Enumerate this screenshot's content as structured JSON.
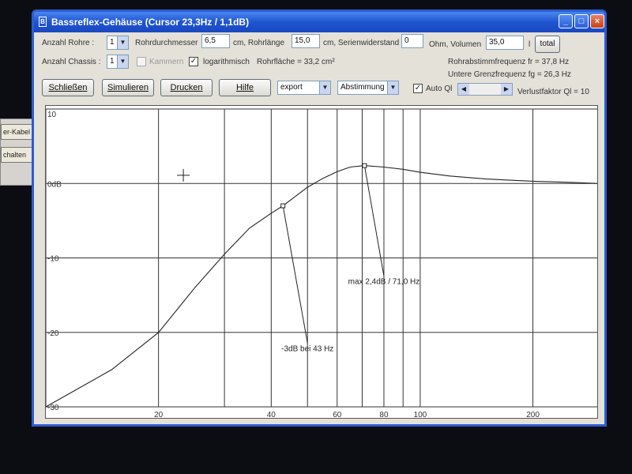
{
  "background_window": {
    "items": [
      "er-Kabel",
      "chalten"
    ]
  },
  "window": {
    "title": "Bassreflex-Gehäuse (Cursor 23,3Hz / 1,1dB)",
    "minimize": "_",
    "maximize": "□",
    "close": "×"
  },
  "params": {
    "anzahl_rohre_label": "Anzahl Rohre :",
    "anzahl_rohre_value": "1",
    "rohrdurchmesser_label": "Rohrdurchmesser",
    "rohrdurchmesser_value": "6,5",
    "rohrlaenge_label": "cm, Rohrlänge",
    "rohrlaenge_value": "15,0",
    "serienwiderstand_label": "cm, Serienwiderstand",
    "serienwiderstand_value": "0",
    "volumen_label": "Ohm, Volumen",
    "volumen_value": "35,0",
    "volumen_unit": "l",
    "total_button": "total",
    "anzahl_chassis_label": "Anzahl Chassis :",
    "anzahl_chassis_value": "1",
    "kammern_label": "Kammern",
    "kammern_checked": false,
    "log_label": "logarithmisch",
    "log_checked": true,
    "rohrflaeche_text": "Rohrfläche = 33,2 cm²",
    "rohrabstimm_text": "Rohrabstimmfrequenz fr = 37,8 Hz",
    "grenzfrequenz_text": "Untere Grenzfrequenz fg = 26,3 Hz"
  },
  "toolbar": {
    "schliessen": "Schließen",
    "simulieren": "Simulieren",
    "drucken": "Drucken",
    "hilfe": "Hilfe",
    "export_value": "export",
    "abstimmung_value": "Abstimmung",
    "auto_ql_label": "Auto Ql",
    "auto_ql_checked": true,
    "verlustfaktor_text": "Verlustfaktor Ql = 10"
  },
  "chart_data": {
    "type": "line",
    "x_scale": "log",
    "xlim": [
      10,
      300
    ],
    "ylim": [
      -30,
      10
    ],
    "x_ticks": [
      20,
      40,
      60,
      80,
      100,
      200
    ],
    "x_tick_labels": [
      "20",
      "40",
      "60",
      "80",
      "100",
      "200"
    ],
    "y_ticks": [
      10,
      0,
      -10,
      -20,
      -30
    ],
    "y_tick_labels": [
      "10",
      "0dB",
      "-10",
      "-20",
      "-30"
    ],
    "x_gridlines": [
      10,
      20,
      30,
      40,
      50,
      60,
      70,
      80,
      90,
      100,
      200,
      300
    ],
    "y_gridlines": [
      10,
      0,
      -10,
      -20,
      -30
    ],
    "grid": true,
    "series": [
      {
        "x": [
          10,
          15,
          20,
          25,
          30,
          35,
          40,
          43,
          50,
          55,
          60,
          65,
          71,
          80,
          90,
          100,
          120,
          150,
          200,
          250,
          300
        ],
        "y": [
          -30.0,
          -25.0,
          -20.0,
          -14.0,
          -9.5,
          -6.0,
          -4.0,
          -3.0,
          -0.5,
          0.7,
          1.6,
          2.2,
          2.4,
          2.2,
          1.9,
          1.5,
          1.0,
          0.6,
          0.3,
          0.15,
          0.0
        ]
      }
    ],
    "annotations": [
      {
        "text": "max 2,4dB / 71,0 Hz",
        "x": 71.0,
        "y": 2.4,
        "label_x": 80,
        "label_y": -13.5
      },
      {
        "text": "-3dB bei  43 Hz",
        "x": 43,
        "y": -3.0,
        "label_x": 50,
        "label_y": -22.5
      }
    ],
    "cursor": {
      "x": 23.3,
      "y": 1.1
    }
  }
}
